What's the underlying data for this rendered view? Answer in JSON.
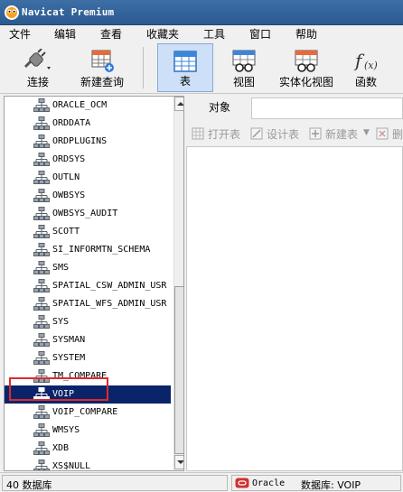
{
  "window": {
    "title": "Navicat Premium",
    "accent_color": "#2f609a"
  },
  "menu": {
    "items": [
      "文件",
      "编辑",
      "查看",
      "收藏夹",
      "工具",
      "窗口",
      "帮助"
    ]
  },
  "toolbar": {
    "connect_label": "连接",
    "new_query_label": "新建查询",
    "table_label": "表",
    "view_label": "视图",
    "mview_label": "实体化视图",
    "function_label": "函数",
    "active": "表"
  },
  "tree": {
    "items": [
      "ORACLE_OCM",
      "ORDDATA",
      "ORDPLUGINS",
      "ORDSYS",
      "OUTLN",
      "OWBSYS",
      "OWBSYS_AUDIT",
      "SCOTT",
      "SI_INFORMTN_SCHEMA",
      "SMS",
      "SPATIAL_CSW_ADMIN_USR",
      "SPATIAL_WFS_ADMIN_USR",
      "SYS",
      "SYSMAN",
      "SYSTEM",
      "TM_COMPARE",
      "VOIP",
      "VOIP_COMPARE",
      "WMSYS",
      "XDB",
      "XS$NULL"
    ],
    "selected": "VOIP",
    "highlight_color": "#e02a2a"
  },
  "objects_panel": {
    "tab_label": "对象",
    "open_table": "打开表",
    "design_table": "设计表",
    "new_table": "新建表",
    "delete_table": "删"
  },
  "status": {
    "count_text": "40 数据库",
    "connection_type": "Oracle",
    "database_text": "数据库: VOIP"
  }
}
